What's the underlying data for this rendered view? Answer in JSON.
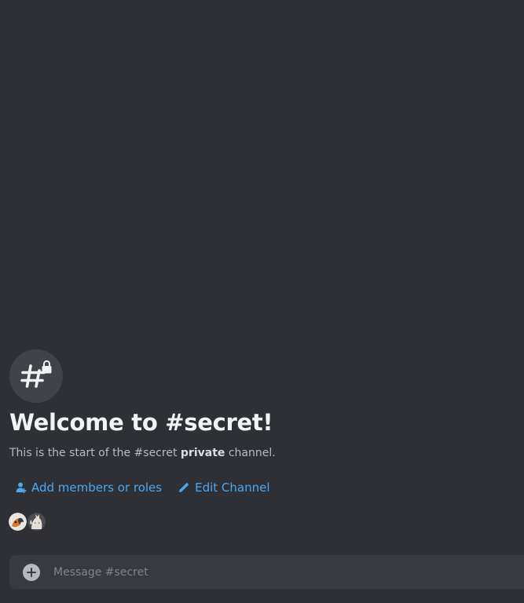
{
  "welcome": {
    "icon": "hashtag-lock-icon",
    "title": "Welcome to #secret!",
    "desc_prefix": "This is the start of the #secret ",
    "desc_bold": "private",
    "desc_suffix": " channel."
  },
  "actions": {
    "add_members_label": "Add members or roles",
    "add_members_icon": "person-add-icon",
    "edit_channel_label": "Edit Channel",
    "edit_channel_icon": "pencil-icon",
    "accent_color": "#4ba7f0"
  },
  "members": [
    {
      "avatar": "member-avatar-1"
    },
    {
      "avatar": "member-avatar-2"
    }
  ],
  "composer": {
    "placeholder": "Message #secret",
    "attach_icon": "plus-circle-icon"
  }
}
